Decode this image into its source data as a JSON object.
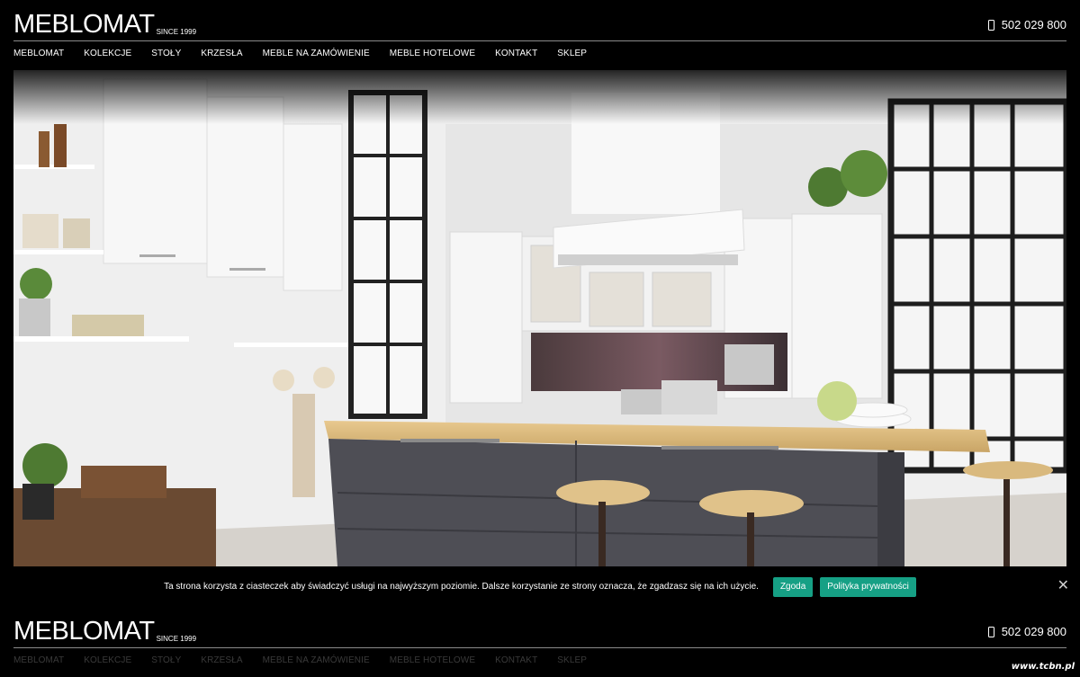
{
  "brand": {
    "name": "MEBLOMAT",
    "since": "SINCE 1999"
  },
  "phone": {
    "icon": "mobile-phone-icon",
    "number": "502 029 800"
  },
  "nav": {
    "items": [
      {
        "label": "MEBLOMAT"
      },
      {
        "label": "KOLEKCJE"
      },
      {
        "label": "STOŁY"
      },
      {
        "label": "KRZESŁA"
      },
      {
        "label": "MEBLE NA ZAMÓWIENIE"
      },
      {
        "label": "MEBLE HOTELOWE"
      },
      {
        "label": "KONTAKT"
      },
      {
        "label": "SKLEP"
      }
    ]
  },
  "hero": {
    "alt": "kitchen-interior-image"
  },
  "cookie": {
    "text": "Ta strona korzysta z ciasteczek aby świadczyć usługi na najwyższym poziomie. Dalsze korzystanie ze strony oznacza, że zgadzasz się na ich użycie.",
    "accept_label": "Zgoda",
    "policy_label": "Polityka prywatności",
    "close_glyph": "✕"
  },
  "colors": {
    "accent": "#16a085",
    "background": "#000000"
  },
  "watermark": "www.tcbn.pl"
}
